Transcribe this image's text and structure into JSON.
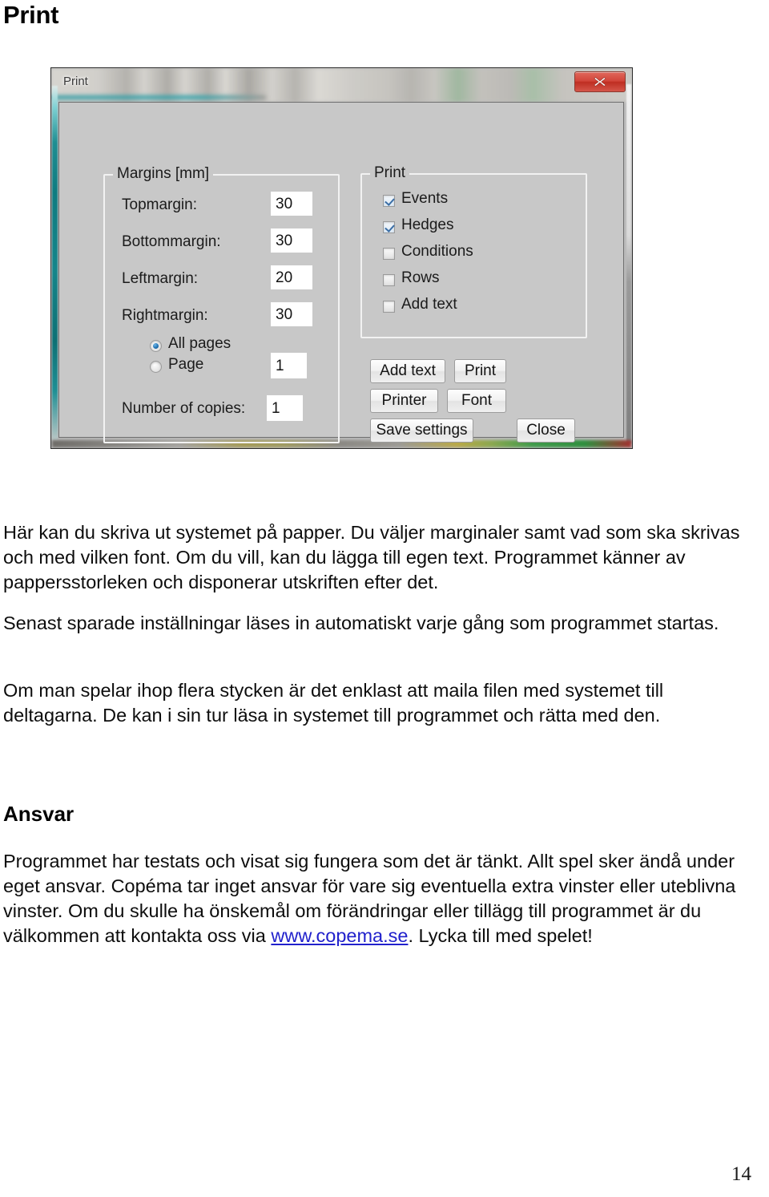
{
  "page": {
    "title": "Print",
    "page_number": "14"
  },
  "dialog": {
    "window_title": "Print",
    "close_icon": "close-icon",
    "margins_group": {
      "legend": "Margins [mm]",
      "fields": [
        {
          "label": "Topmargin:",
          "value": "30"
        },
        {
          "label": "Bottommargin:",
          "value": "30"
        },
        {
          "label": "Leftmargin:",
          "value": "20"
        },
        {
          "label": "Rightmargin:",
          "value": "30"
        }
      ],
      "page_scope": {
        "all_pages_label": "All pages",
        "all_pages_selected": true,
        "page_label": "Page",
        "page_selected": false,
        "page_value": "1"
      },
      "copies": {
        "label": "Number of copies:",
        "value": "1"
      }
    },
    "print_group": {
      "legend": "Print",
      "options": [
        {
          "label": "Events",
          "checked": true
        },
        {
          "label": "Hedges",
          "checked": true
        },
        {
          "label": "Conditions",
          "checked": false
        },
        {
          "label": "Rows",
          "checked": false
        },
        {
          "label": "Add text",
          "checked": false
        }
      ]
    },
    "buttons": {
      "add_text": "Add text",
      "print": "Print",
      "printer": "Printer",
      "font": "Font",
      "save_settings": "Save settings",
      "close": "Close"
    }
  },
  "content": {
    "paragraph_1": "Här kan du skriva ut systemet på papper. Du väljer marginaler samt vad som ska skrivas och med vilken font. Om du vill, kan du lägga till egen text. Programmet känner av pappersstorleken och disponerar utskriften efter det.",
    "paragraph_2": "Senast sparade inställningar läses in automatiskt varje gång som programmet startas.",
    "paragraph_3": "Om man spelar ihop flera stycken är det enklast att maila filen med systemet till deltagarna. De kan i sin tur läsa in systemet till programmet och rätta med den.",
    "section_heading": "Ansvar",
    "paragraph_4_part_1": "Programmet har testats och visat sig fungera som det är tänkt. Allt spel sker ändå under eget ansvar. Copéma tar inget ansvar för vare sig eventuella extra vinster eller uteblivna vinster. Om du skulle ha önskemål om förändringar eller tillägg till programmet är du välkommen att kontakta oss via ",
    "link_text": "www.copema.se",
    "paragraph_4_part_2": ". Lycka till med spelet!"
  },
  "colors": {
    "link": "#2121cc",
    "dialog_face": "#c8c8c8",
    "close_button": "#d2453a",
    "accent_teal": "#148589"
  }
}
